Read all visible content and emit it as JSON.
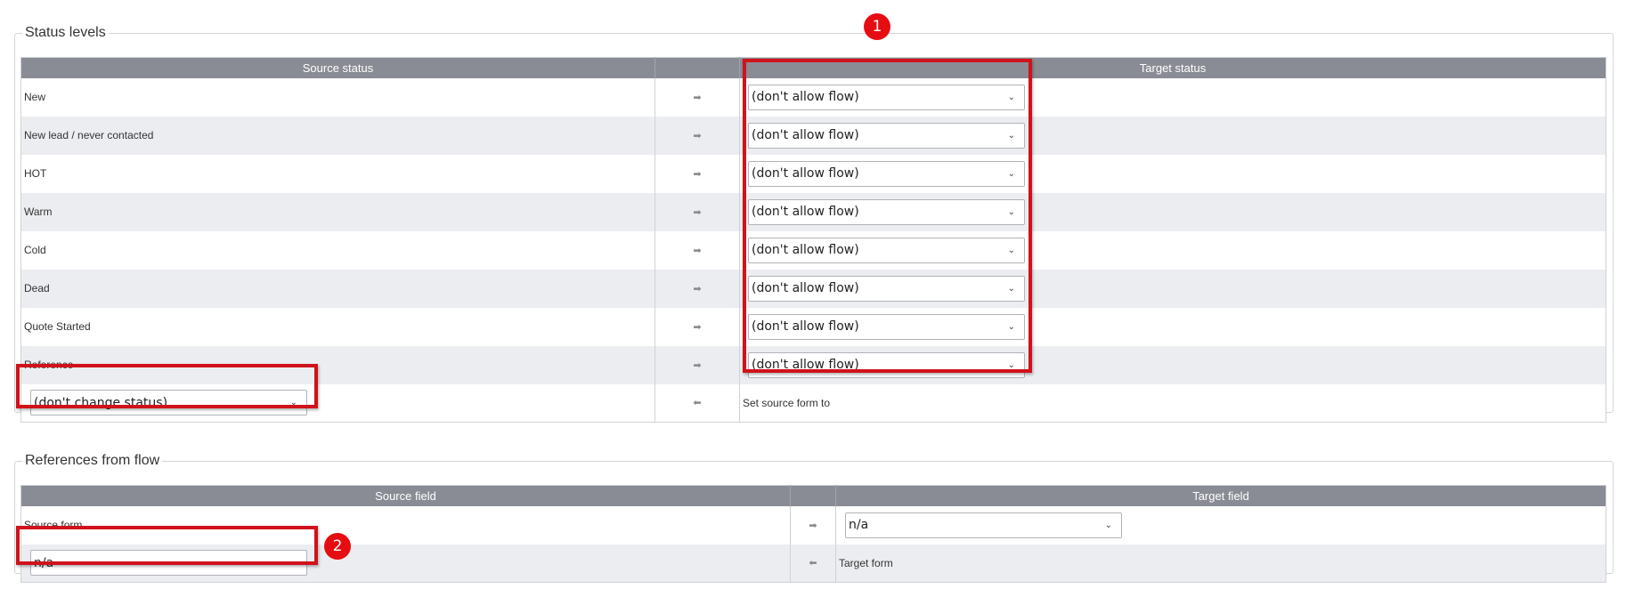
{
  "status_section": {
    "legend": "Status levels",
    "header_source": "Source status",
    "header_target": "Target status",
    "rows": [
      {
        "source": "New",
        "arrow": "➡",
        "target": "(don't allow flow)"
      },
      {
        "source": "New lead / never contacted",
        "arrow": "➡",
        "target": "(don't allow flow)"
      },
      {
        "source": "HOT",
        "arrow": "➡",
        "target": "(don't allow flow)"
      },
      {
        "source": "Warm",
        "arrow": "➡",
        "target": "(don't allow flow)"
      },
      {
        "source": "Cold",
        "arrow": "➡",
        "target": "(don't allow flow)"
      },
      {
        "source": "Dead",
        "arrow": "➡",
        "target": "(don't allow flow)"
      },
      {
        "source": "Quote Started",
        "arrow": "➡",
        "target": "(don't allow flow)"
      },
      {
        "source": "Reference",
        "arrow": "➡",
        "target": "(don't allow flow)"
      }
    ],
    "footer_row": {
      "source_select": "(don't change status)",
      "arrow": "⬅",
      "target_text": "Set source form to"
    }
  },
  "refs_section": {
    "legend": "References from flow",
    "header_source": "Source field",
    "header_target": "Target field",
    "row1": {
      "source": "Source form",
      "arrow": "➡",
      "target_select": "n/a"
    },
    "row2": {
      "source_select": "n/a",
      "arrow": "⬅",
      "target": "Target form"
    }
  },
  "chevron": "⌄",
  "badges": {
    "one": "1",
    "two": "2"
  },
  "highlight_color": "#d0121b"
}
